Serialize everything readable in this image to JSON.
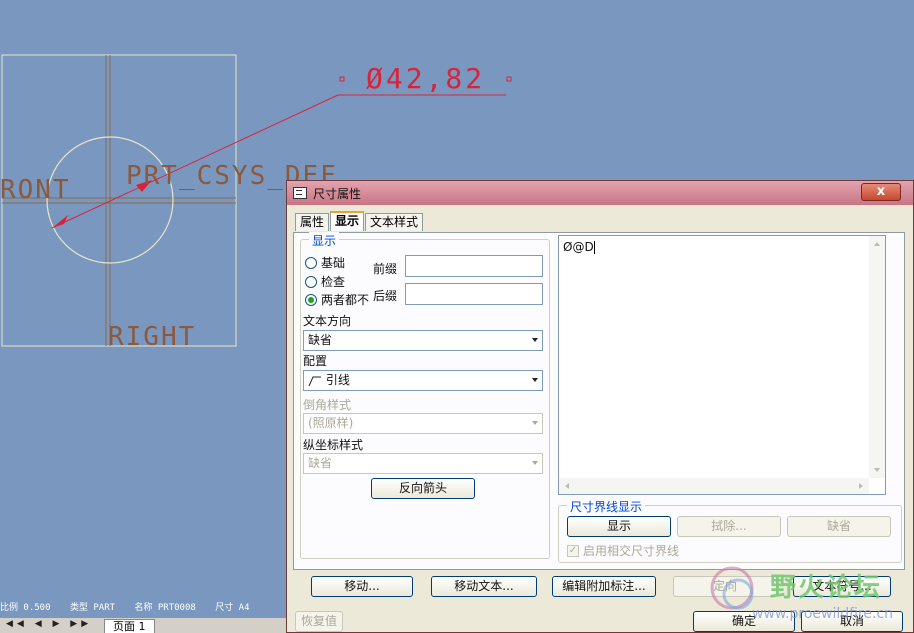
{
  "cad": {
    "dimension_text": "Ø42,82",
    "csys_label": "PRT_CSYS_DEF",
    "front_label": "RONT",
    "right_label": "RIGHT",
    "line_color": "#d8243a",
    "geometry_color": "#8b5a3c"
  },
  "status": {
    "scale": "比例 0.500",
    "type": "类型 PART",
    "name": "名称 PRT0008",
    "size": "尺寸 A4"
  },
  "pagebar": {
    "nav": "◀◀ ◀ ▶ ▶▶",
    "tab_label": "页面 1"
  },
  "dialog": {
    "title": "尺寸属性",
    "close_label": "x",
    "tabs": [
      {
        "label": "属性"
      },
      {
        "label": "显示"
      },
      {
        "label": "文本样式"
      }
    ],
    "display_group": {
      "title": "显示",
      "options": [
        {
          "label": "基础",
          "selected": false
        },
        {
          "label": "检查",
          "selected": false
        },
        {
          "label": "两者都不",
          "selected": true
        }
      ],
      "prefix_label": "前缀",
      "prefix_value": "",
      "suffix_label": "后缀",
      "suffix_value": ""
    },
    "text_direction_label": "文本方向",
    "text_direction_value": "缺省",
    "config_label": "配置",
    "config_value": "引线",
    "chamfer_style_label": "倒角样式",
    "chamfer_style_value": "(照原样)",
    "ordinate_style_label": "纵坐标样式",
    "ordinate_style_value": "缺省",
    "flip_arrows_label": "反向箭头",
    "text_content": "Ø@D",
    "witness_group": {
      "title": "尺寸界线显示",
      "show_label": "显示",
      "erase_label": "拭除...",
      "default_label": "缺省",
      "enable_label": "启用相交尺寸界线"
    },
    "bottom_buttons": {
      "move": "移动...",
      "move_text": "移动文本...",
      "edit_attach": "编辑附加标注...",
      "orientation": "定向",
      "text_symbol": "文本符号..."
    },
    "restore_label": "恢复值",
    "ok_label": "确定",
    "cancel_label": "取消"
  },
  "watermark": {
    "text": "野火论坛",
    "url": "www.proewildfire.cn"
  }
}
